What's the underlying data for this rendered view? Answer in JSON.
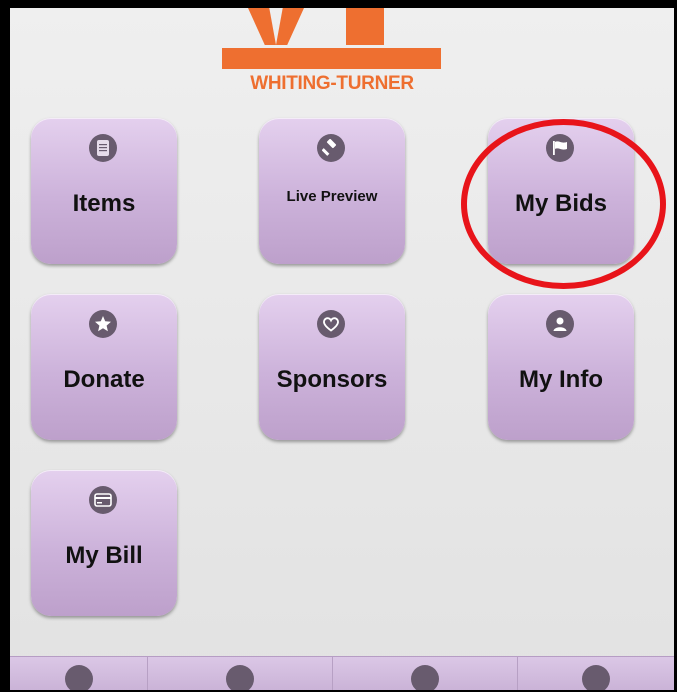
{
  "logo": {
    "wordmark": "WHITING-TURNER"
  },
  "tiles": [
    {
      "label": "Items",
      "icon": "document-icon"
    },
    {
      "label": "Live Preview",
      "icon": "gavel-icon"
    },
    {
      "label": "My Bids",
      "icon": "flag-icon"
    },
    {
      "label": "Donate",
      "icon": "star-icon"
    },
    {
      "label": "Sponsors",
      "icon": "heart-icon"
    },
    {
      "label": "My Info",
      "icon": "person-icon"
    },
    {
      "label": "My Bill",
      "icon": "credit-card-icon"
    }
  ],
  "highlight": {
    "target": "My Bids",
    "color": "#e8141a"
  },
  "tabbar": {
    "icons": [
      "home-icon",
      "document-icon",
      "flag-icon",
      "star-icon"
    ]
  },
  "colors": {
    "brand": "#ee6f30",
    "tile": "#ccb2da",
    "icon": "#685b6e"
  }
}
